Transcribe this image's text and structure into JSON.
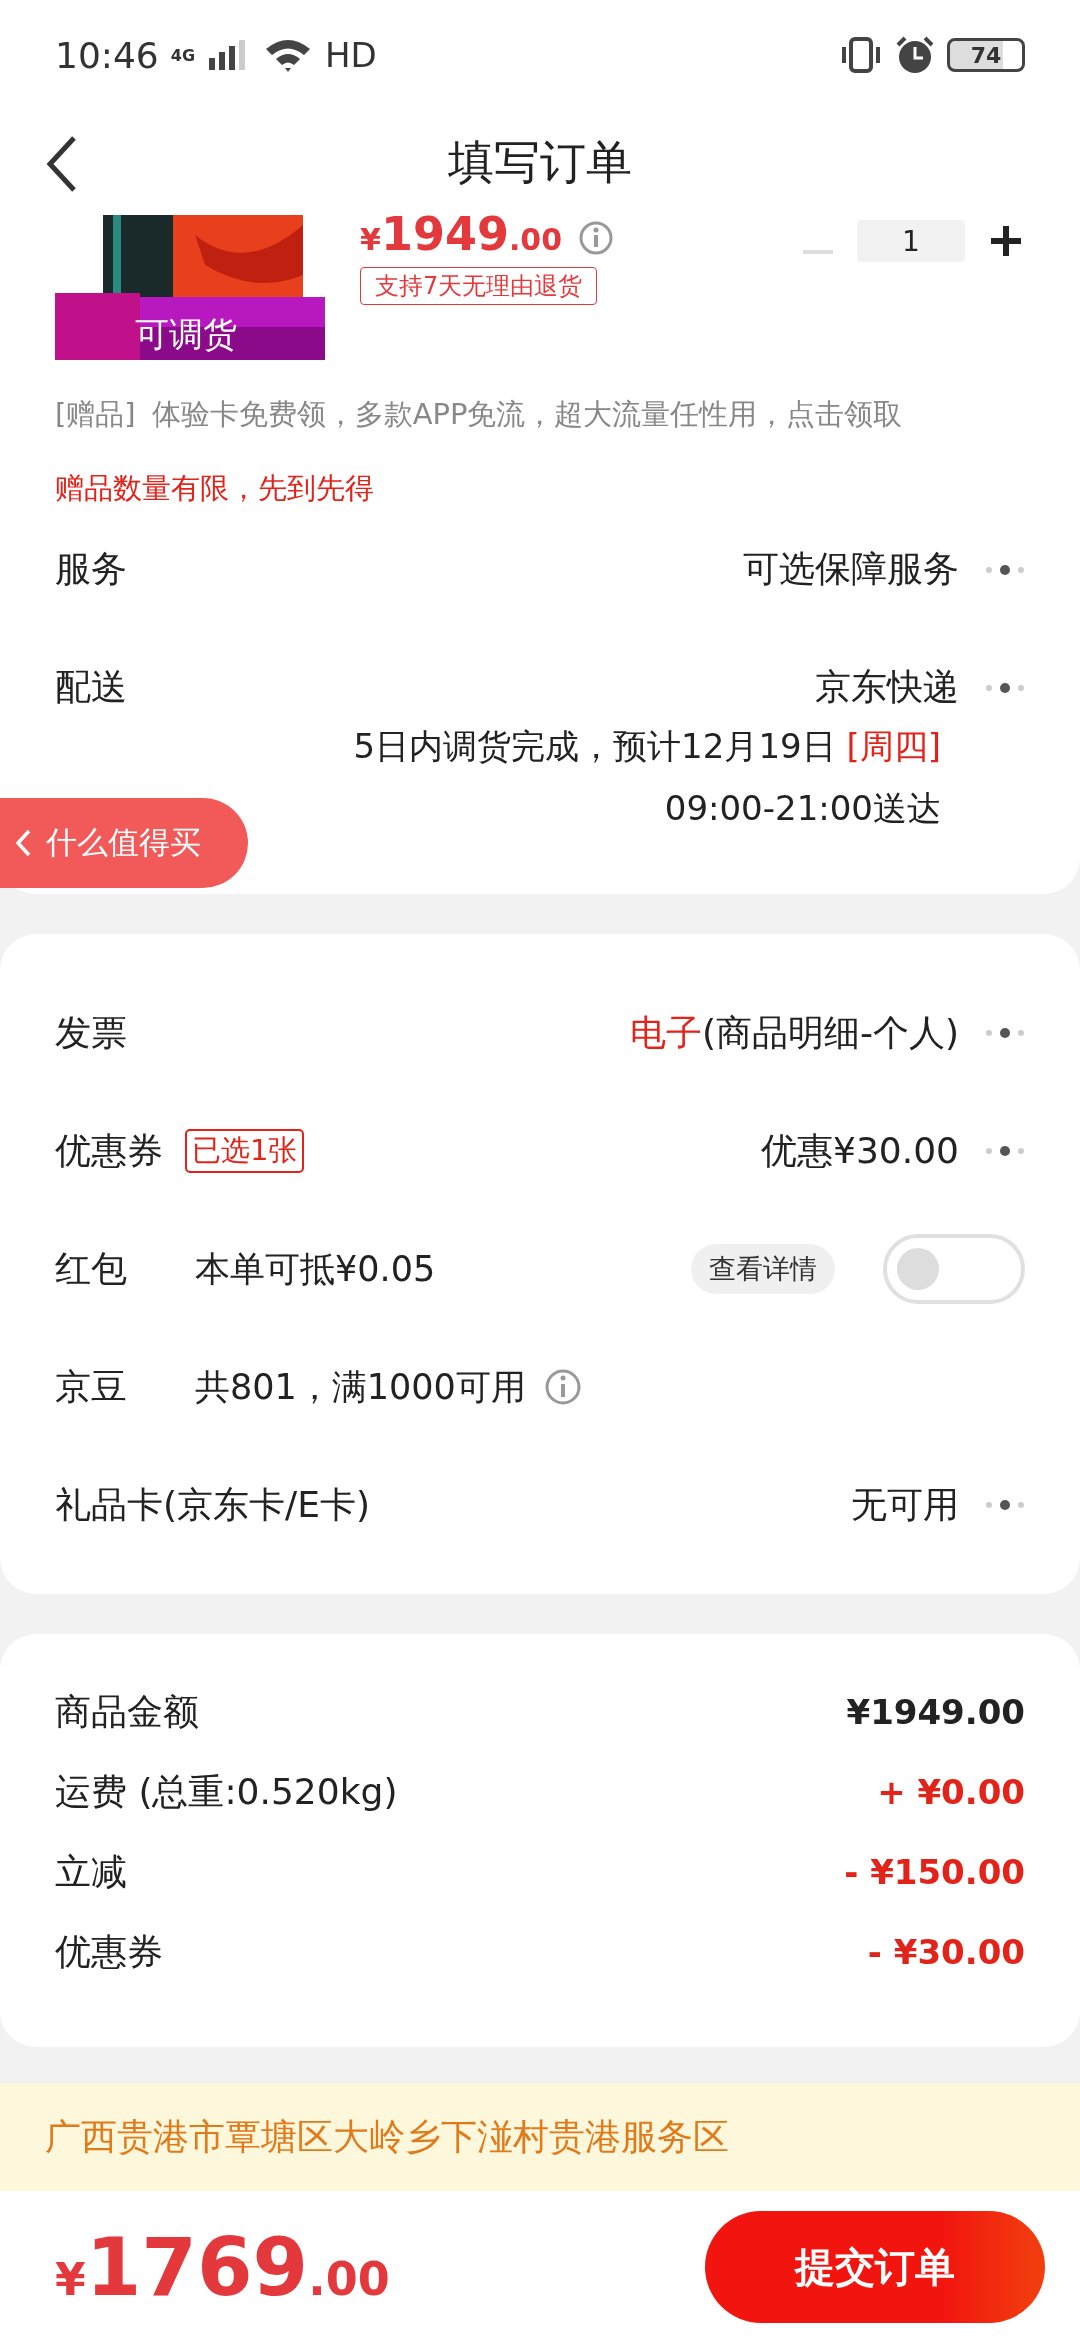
{
  "status_bar": {
    "time": "10:46",
    "network": "4G",
    "hd": "HD",
    "battery": "74"
  },
  "header": {
    "title": "填写订单"
  },
  "product": {
    "stock_label": "可调货",
    "currency": "¥",
    "price_main": "1949",
    "price_decimal": ".00",
    "return_tag": "支持7天无理由退货",
    "quantity": "1",
    "minus_disabled": true
  },
  "gift": {
    "tag": "[赠品]",
    "text": "体验卡免费领，多款APP免流，超大流量任性用，点击领取"
  },
  "gift_notice": "赠品数量有限，先到先得",
  "service": {
    "label": "服务",
    "value": "可选保障服务"
  },
  "delivery": {
    "label": "配送",
    "value": "京东快递",
    "estimate": "5日内调货完成，预计12月19日",
    "weekday": "[周四]",
    "window": "09:00-21:00送达"
  },
  "float_tab": {
    "label": "什么值得买"
  },
  "options": [
    {
      "kind": "link",
      "label": "发票",
      "highlight": "电子",
      "value": "(商品明细-个人)"
    },
    {
      "kind": "link",
      "label": "优惠券",
      "badge": "已选1张",
      "value": "优惠¥30.00"
    },
    {
      "kind": "toggle",
      "label": "红包",
      "detail": "本单可抵¥0.05",
      "button": "查看详情",
      "on": false
    },
    {
      "kind": "info",
      "label": "京豆",
      "detail": "共801，满1000可用"
    },
    {
      "kind": "link",
      "label": "礼品卡(京东卡/E卡)",
      "value": "无可用"
    }
  ],
  "summary": [
    {
      "label": "商品金额",
      "value": "¥1949.00",
      "color": "#222222"
    },
    {
      "label": "运费 (总重:0.520kg)",
      "value": "+ ¥0.00",
      "color": "#e2231a"
    },
    {
      "label": "立减",
      "value": "- ¥150.00",
      "color": "#e2231a"
    },
    {
      "label": "优惠券",
      "value": "- ¥30.00",
      "color": "#e2231a"
    }
  ],
  "address": "广西贵港市覃塘区大岭乡下湴村贵港服务区",
  "total": {
    "currency": "¥",
    "main": "1769",
    "decimal": ".00"
  },
  "submit": {
    "label": "提交订单"
  }
}
